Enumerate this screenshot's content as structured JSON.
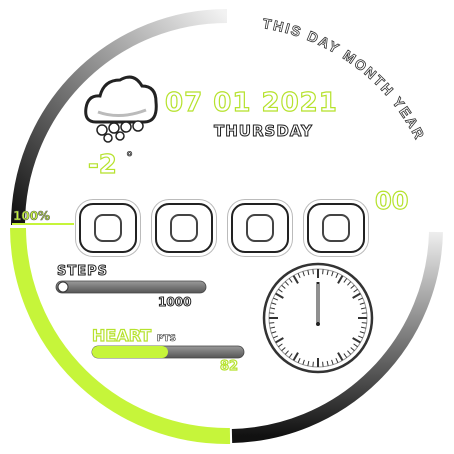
{
  "date": {
    "day": "07",
    "month": "01",
    "year": "2021",
    "weekday": "THURSDAY"
  },
  "curved_label": "THIS DAY MONTH YEAR",
  "weather": {
    "icon": "cloud-snow-icon",
    "temperature": "-2",
    "unit": "°"
  },
  "time": {
    "digits": [
      "0",
      "0",
      "0",
      "0"
    ],
    "seconds": "00"
  },
  "battery": {
    "label": "100%",
    "level": 1.0
  },
  "steps": {
    "label": "STEPS",
    "value": "1000",
    "progress": 0.05
  },
  "heart": {
    "label": "HEART",
    "unit": "PTS",
    "value": "82",
    "progress": 0.5
  },
  "colors": {
    "accent": "#c6f53a",
    "dark": "#222222",
    "track": "#6b6b6b"
  }
}
